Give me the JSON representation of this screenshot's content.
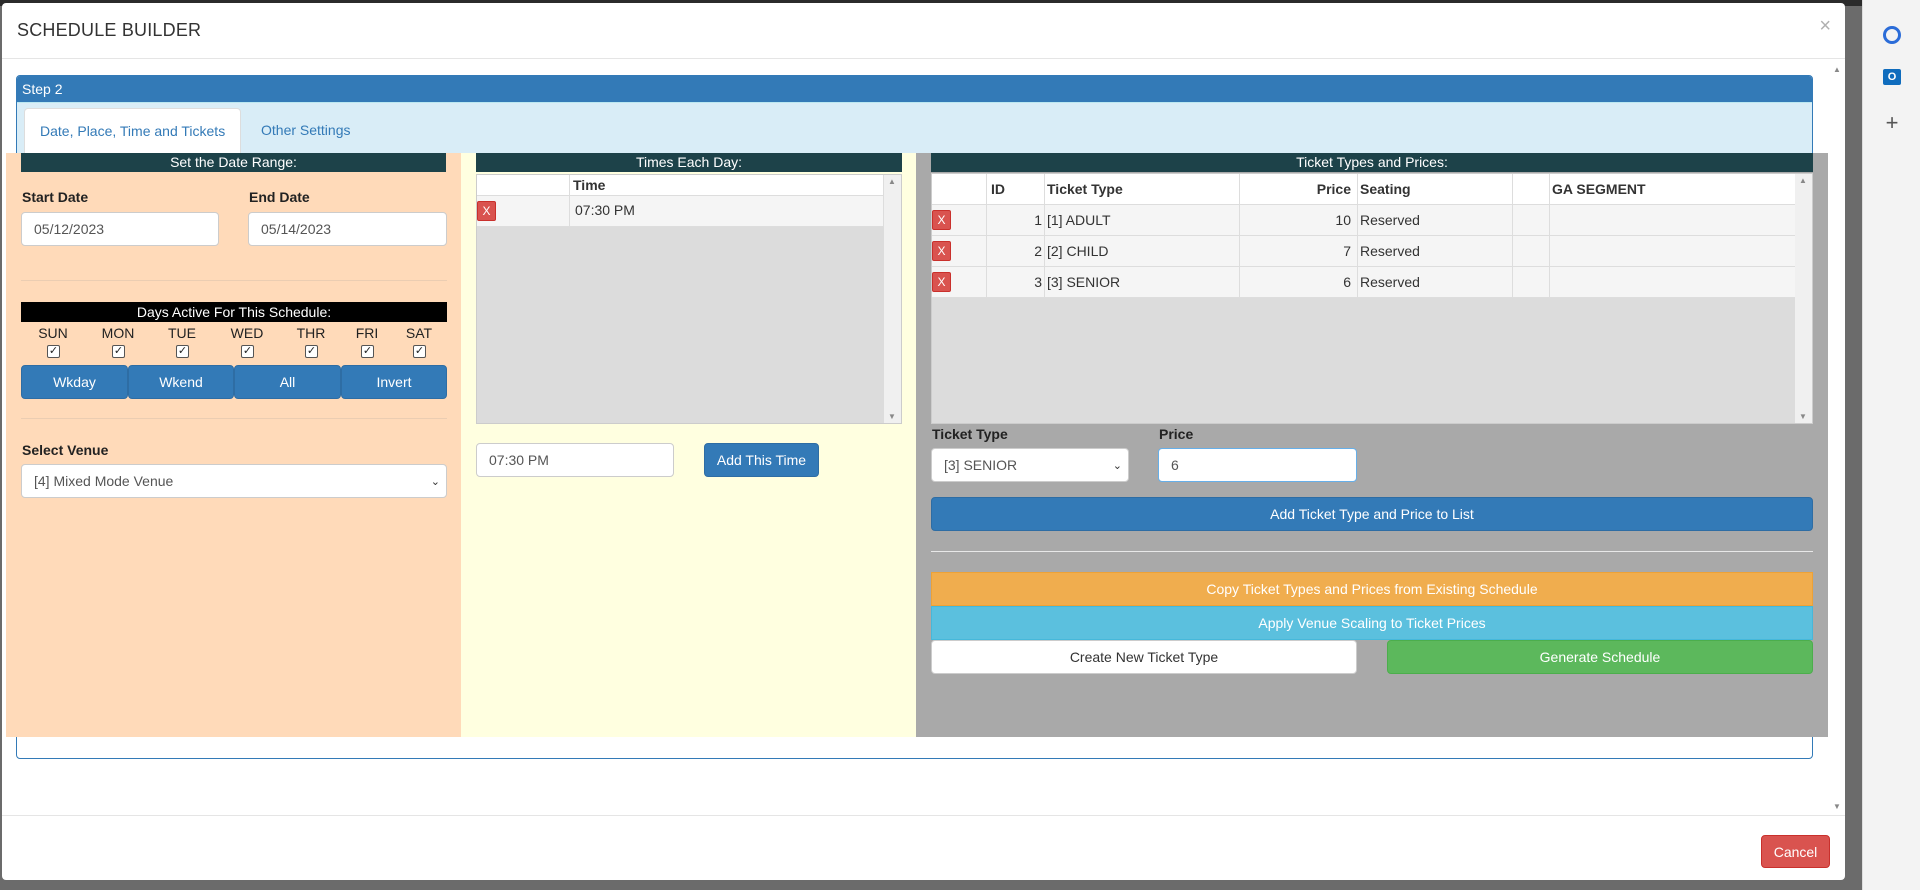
{
  "modal": {
    "title": "SCHEDULE BUILDER",
    "close": "×",
    "cancel_label": "Cancel"
  },
  "step": {
    "heading": "Step 2"
  },
  "tabs": [
    {
      "label": "Date, Place, Time and Tickets",
      "active": true
    },
    {
      "label": "Other Settings",
      "active": false
    }
  ],
  "date_range": {
    "heading": "Set the Date Range:",
    "start_label": "Start Date",
    "start_value": "05/12/2023",
    "end_label": "End Date",
    "end_value": "05/14/2023"
  },
  "days": {
    "heading": "Days Active For This Schedule:",
    "items": [
      {
        "label": "SUN",
        "checked": true
      },
      {
        "label": "MON",
        "checked": true
      },
      {
        "label": "TUE",
        "checked": true
      },
      {
        "label": "WED",
        "checked": true
      },
      {
        "label": "THR",
        "checked": true
      },
      {
        "label": "FRI",
        "checked": true
      },
      {
        "label": "SAT",
        "checked": true
      }
    ],
    "buttons": [
      "Wkday",
      "Wkend",
      "All",
      "Invert"
    ]
  },
  "venue": {
    "label": "Select Venue",
    "value": "[4] Mixed Mode Venue"
  },
  "times": {
    "heading": "Times Each Day:",
    "column": "Time",
    "rows": [
      {
        "delete": "X",
        "time": "07:30 PM"
      }
    ],
    "input_value": "07:30 PM",
    "add_label": "Add This Time"
  },
  "tickets": {
    "heading": "Ticket Types and Prices:",
    "columns": {
      "id": "ID",
      "type": "Ticket Type",
      "price": "Price",
      "seating": "Seating",
      "ga": "GA SEGMENT"
    },
    "rows": [
      {
        "delete": "X",
        "id": "1",
        "type": "[1] ADULT",
        "price": "10",
        "seating": "Reserved"
      },
      {
        "delete": "X",
        "id": "2",
        "type": "[2] CHILD",
        "price": "7",
        "seating": "Reserved"
      },
      {
        "delete": "X",
        "id": "3",
        "type": "[3] SENIOR",
        "price": "6",
        "seating": "Reserved"
      }
    ],
    "type_label": "Ticket Type",
    "type_value": "[3] SENIOR",
    "price_label": "Price",
    "price_value": "6",
    "add_label": "Add Ticket Type and Price to List",
    "copy_label": "Copy Ticket Types and Prices from Existing Schedule",
    "apply_label": "Apply Venue Scaling to Ticket Prices",
    "create_label": "Create New Ticket Type",
    "generate_label": "Generate Schedule"
  },
  "colors": {
    "primary": "#337ab7",
    "danger": "#d9534f",
    "warning": "#f0ad4e",
    "info": "#5bc0de",
    "success": "#5cb85c",
    "left_bg": "#ffdab9",
    "mid_bg": "#ffffe0",
    "right_bg": "#a9a9a9"
  }
}
